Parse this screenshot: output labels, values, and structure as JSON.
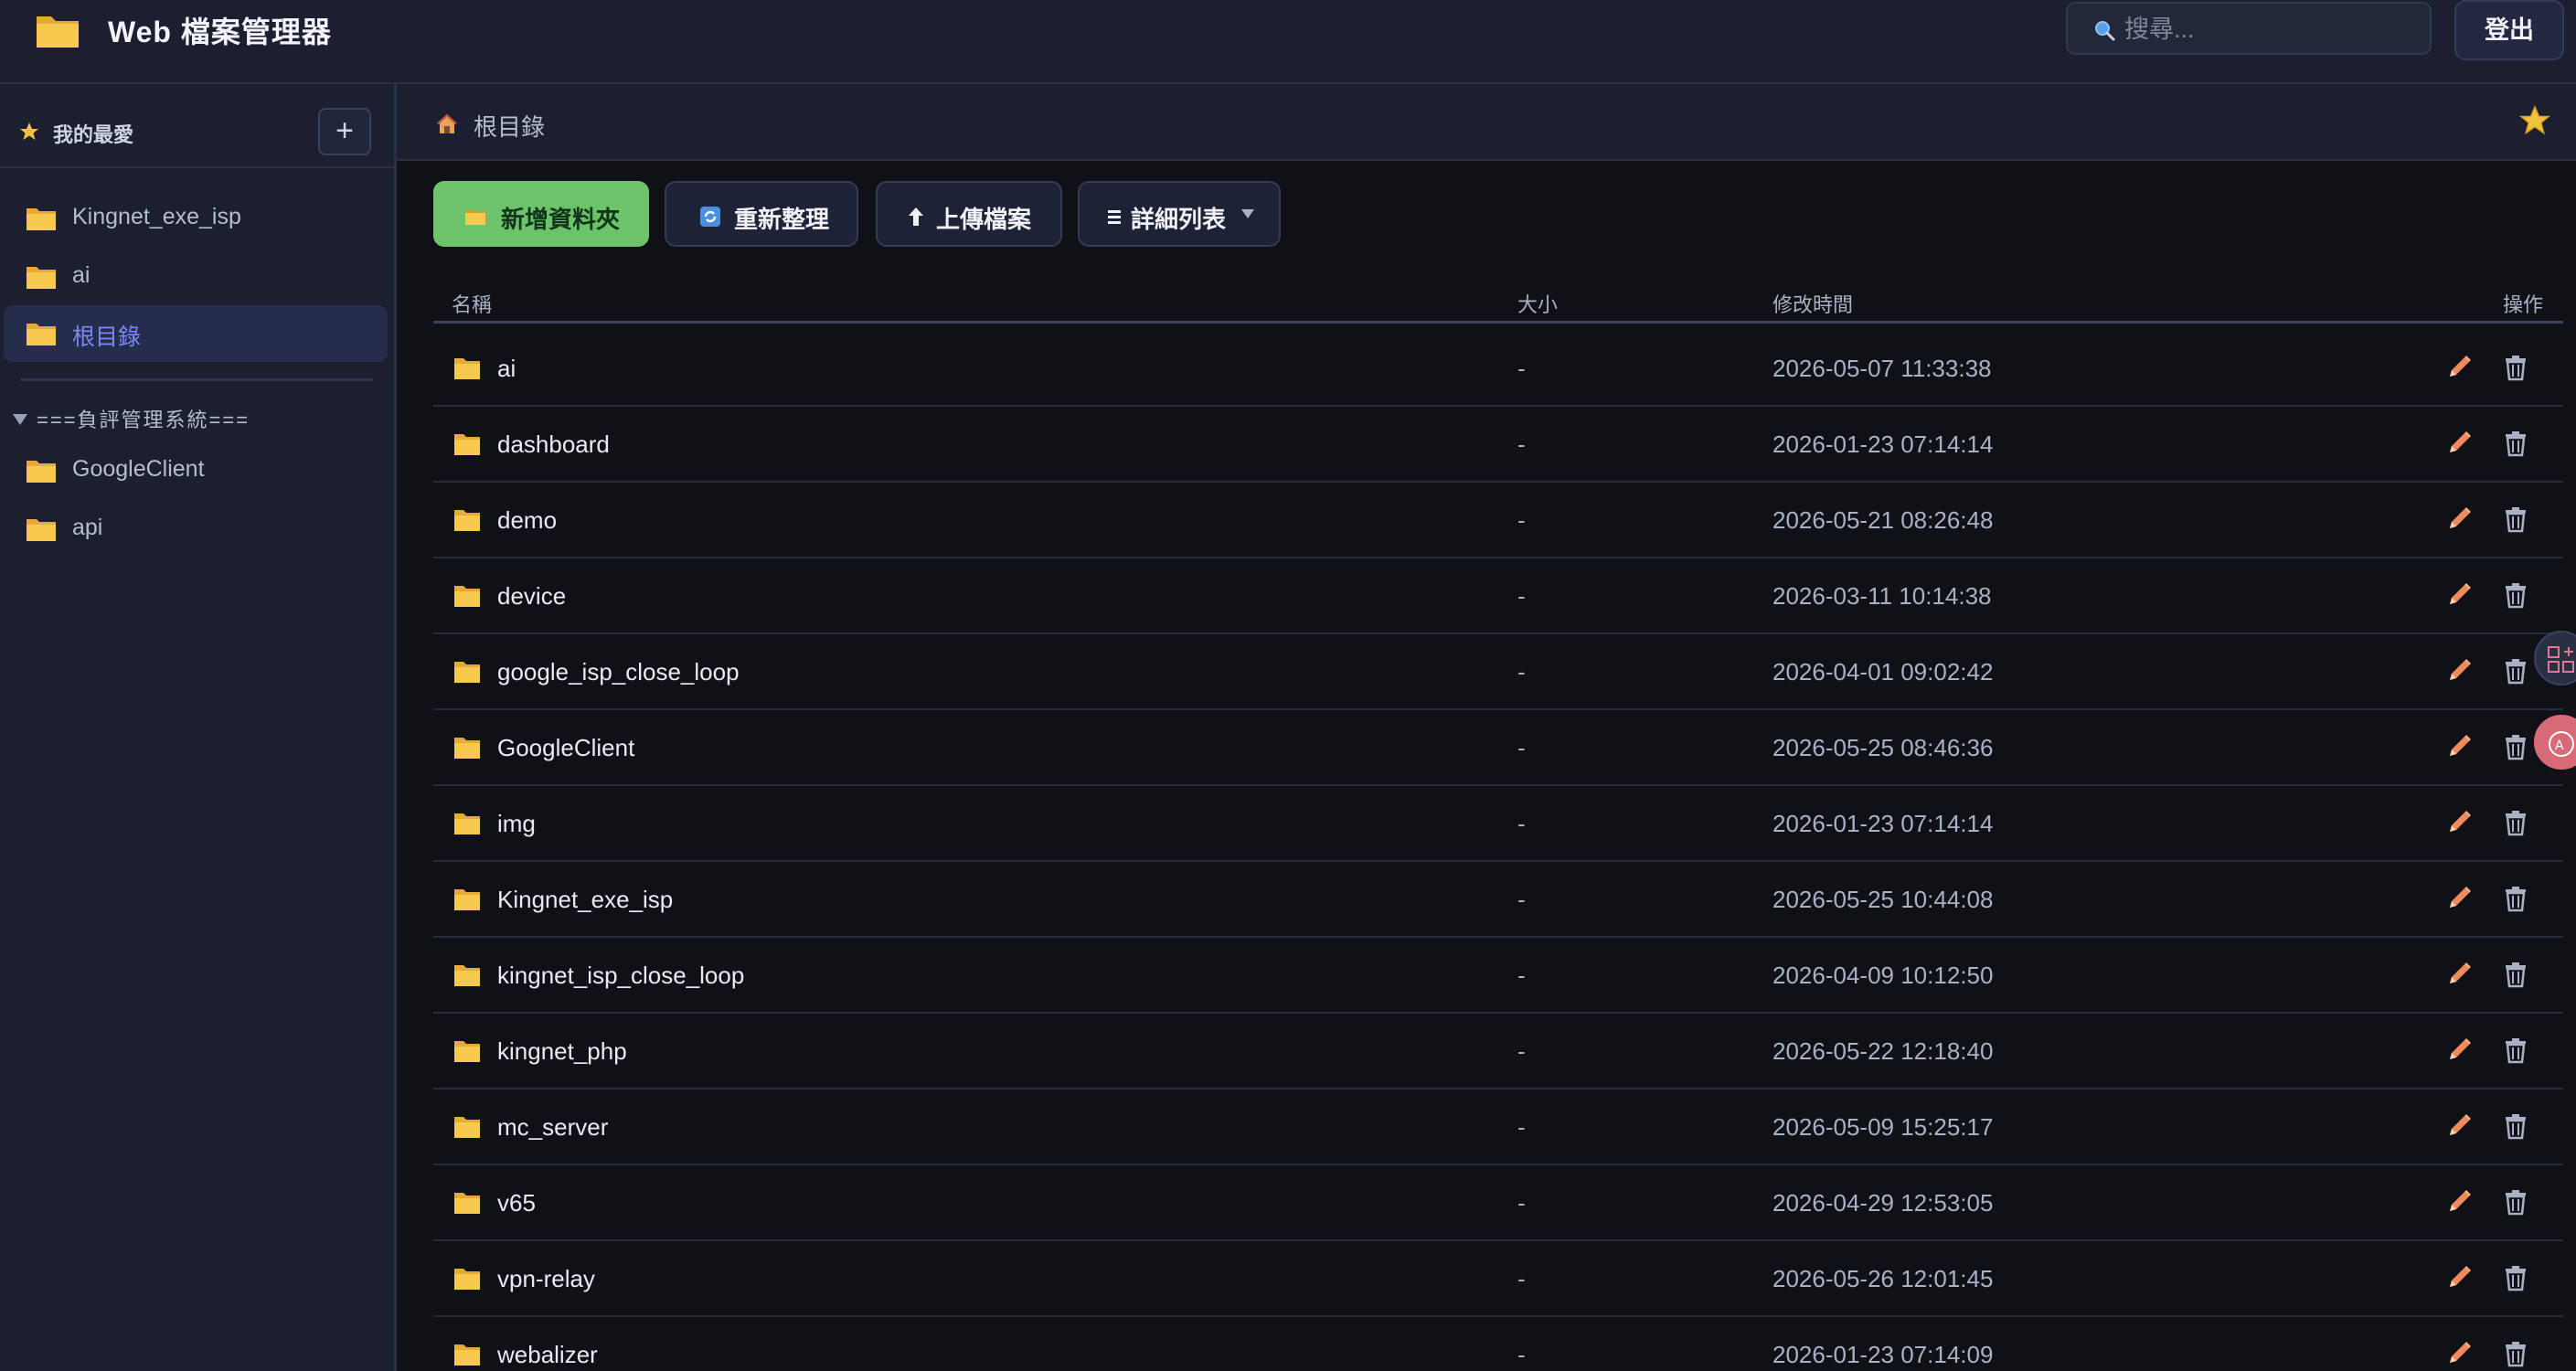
{
  "app": {
    "title": "Web 檔案管理器"
  },
  "search": {
    "placeholder": "搜尋..."
  },
  "header": {
    "logout_label": "登出"
  },
  "sidebar": {
    "favorites_title": "我的最愛",
    "add_label": "+",
    "items": [
      {
        "label": "Kingnet_exe_isp",
        "active": false
      },
      {
        "label": "ai",
        "active": false
      },
      {
        "label": "根目錄",
        "active": true
      }
    ],
    "group": {
      "title": "===負評管理系統===",
      "items": [
        {
          "label": "GoogleClient"
        },
        {
          "label": "api"
        }
      ]
    }
  },
  "breadcrumb": {
    "label": "根目錄"
  },
  "toolbar": {
    "new_folder": "新增資料夾",
    "refresh": "重新整理",
    "upload": "上傳檔案",
    "view_mode": "詳細列表"
  },
  "table": {
    "columns": {
      "name": "名稱",
      "size": "大小",
      "modified": "修改時間",
      "actions": "操作"
    },
    "rows": [
      {
        "name": "ai",
        "size": "-",
        "modified": "2026-05-07 11:33:38"
      },
      {
        "name": "dashboard",
        "size": "-",
        "modified": "2026-01-23 07:14:14"
      },
      {
        "name": "demo",
        "size": "-",
        "modified": "2026-05-21 08:26:48"
      },
      {
        "name": "device",
        "size": "-",
        "modified": "2026-03-11 10:14:38"
      },
      {
        "name": "google_isp_close_loop",
        "size": "-",
        "modified": "2026-04-01 09:02:42"
      },
      {
        "name": "GoogleClient",
        "size": "-",
        "modified": "2026-05-25 08:46:36"
      },
      {
        "name": "img",
        "size": "-",
        "modified": "2026-01-23 07:14:14"
      },
      {
        "name": "Kingnet_exe_isp",
        "size": "-",
        "modified": "2026-05-25 10:44:08"
      },
      {
        "name": "kingnet_isp_close_loop",
        "size": "-",
        "modified": "2026-04-09 10:12:50"
      },
      {
        "name": "kingnet_php",
        "size": "-",
        "modified": "2026-05-22 12:18:40"
      },
      {
        "name": "mc_server",
        "size": "-",
        "modified": "2026-05-09 15:25:17"
      },
      {
        "name": "v65",
        "size": "-",
        "modified": "2026-04-29 12:53:05"
      },
      {
        "name": "vpn-relay",
        "size": "-",
        "modified": "2026-05-26 12:01:45"
      },
      {
        "name": "webalizer",
        "size": "-",
        "modified": "2026-01-23 07:14:09"
      }
    ]
  },
  "colors": {
    "accent": "#7b88f5",
    "primary_button": "#6cc36a",
    "folder": "#f5c04a",
    "edit": "#f08a5d",
    "delete": "#aab1c4"
  }
}
